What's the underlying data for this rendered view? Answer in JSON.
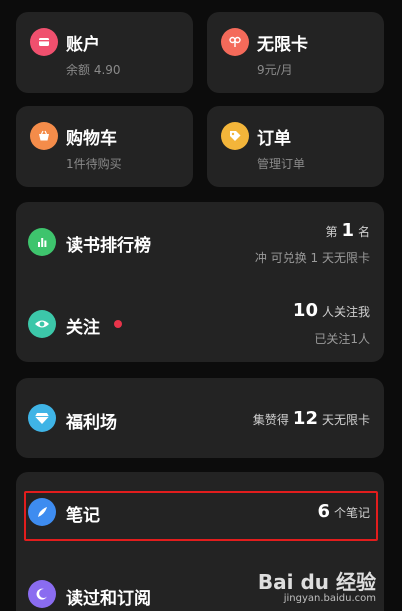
{
  "grid": {
    "account": {
      "title": "账户",
      "subtitle": "余额 4.90",
      "icon": "wallet-icon",
      "icon_color": "#f0506e"
    },
    "unlimited": {
      "title": "无限卡",
      "subtitle": "9元/月",
      "icon": "ribbon-icon",
      "icon_color": "#f46a5a"
    },
    "cart": {
      "title": "购物车",
      "subtitle": "1件待购买",
      "icon": "basket-icon",
      "icon_color": "#f48c4a"
    },
    "orders": {
      "title": "订单",
      "subtitle": "管理订单",
      "icon": "tag-icon",
      "icon_color": "#f3b53a"
    }
  },
  "group1": {
    "ranking": {
      "title": "读书排行榜",
      "rank_prefix": "第",
      "rank_value": "1",
      "rank_suffix": "名",
      "exchange_text": "冲 可兑换 1 天无限卡",
      "icon": "bar-chart-icon",
      "icon_color": "#3ec46d"
    },
    "follow": {
      "title": "关注",
      "followers_value": "10",
      "followers_suffix": "人关注我",
      "following_text": "已关注1人",
      "icon": "eye-icon",
      "icon_color": "#3cc7a9",
      "badge_color": "#e8344a"
    }
  },
  "welfare": {
    "title": "福利场",
    "prefix": "集赞得",
    "value": "12",
    "suffix": "天无限卡",
    "icon": "diamond-icon",
    "icon_color": "#3fb4e6"
  },
  "group2": {
    "notes": {
      "title": "笔记",
      "value": "6",
      "suffix": "个笔记",
      "icon": "feather-icon",
      "icon_color": "#3e8cf0"
    },
    "history": {
      "title": "读过和订阅",
      "icon": "moon-icon",
      "icon_color": "#8a6cf0"
    }
  },
  "watermark": {
    "brand": "Bai du 经验",
    "site": "jingyan.baidu.com"
  },
  "colors": {
    "background": "#0c0c0c",
    "card": "#232323",
    "highlight": "#e21d1d"
  }
}
